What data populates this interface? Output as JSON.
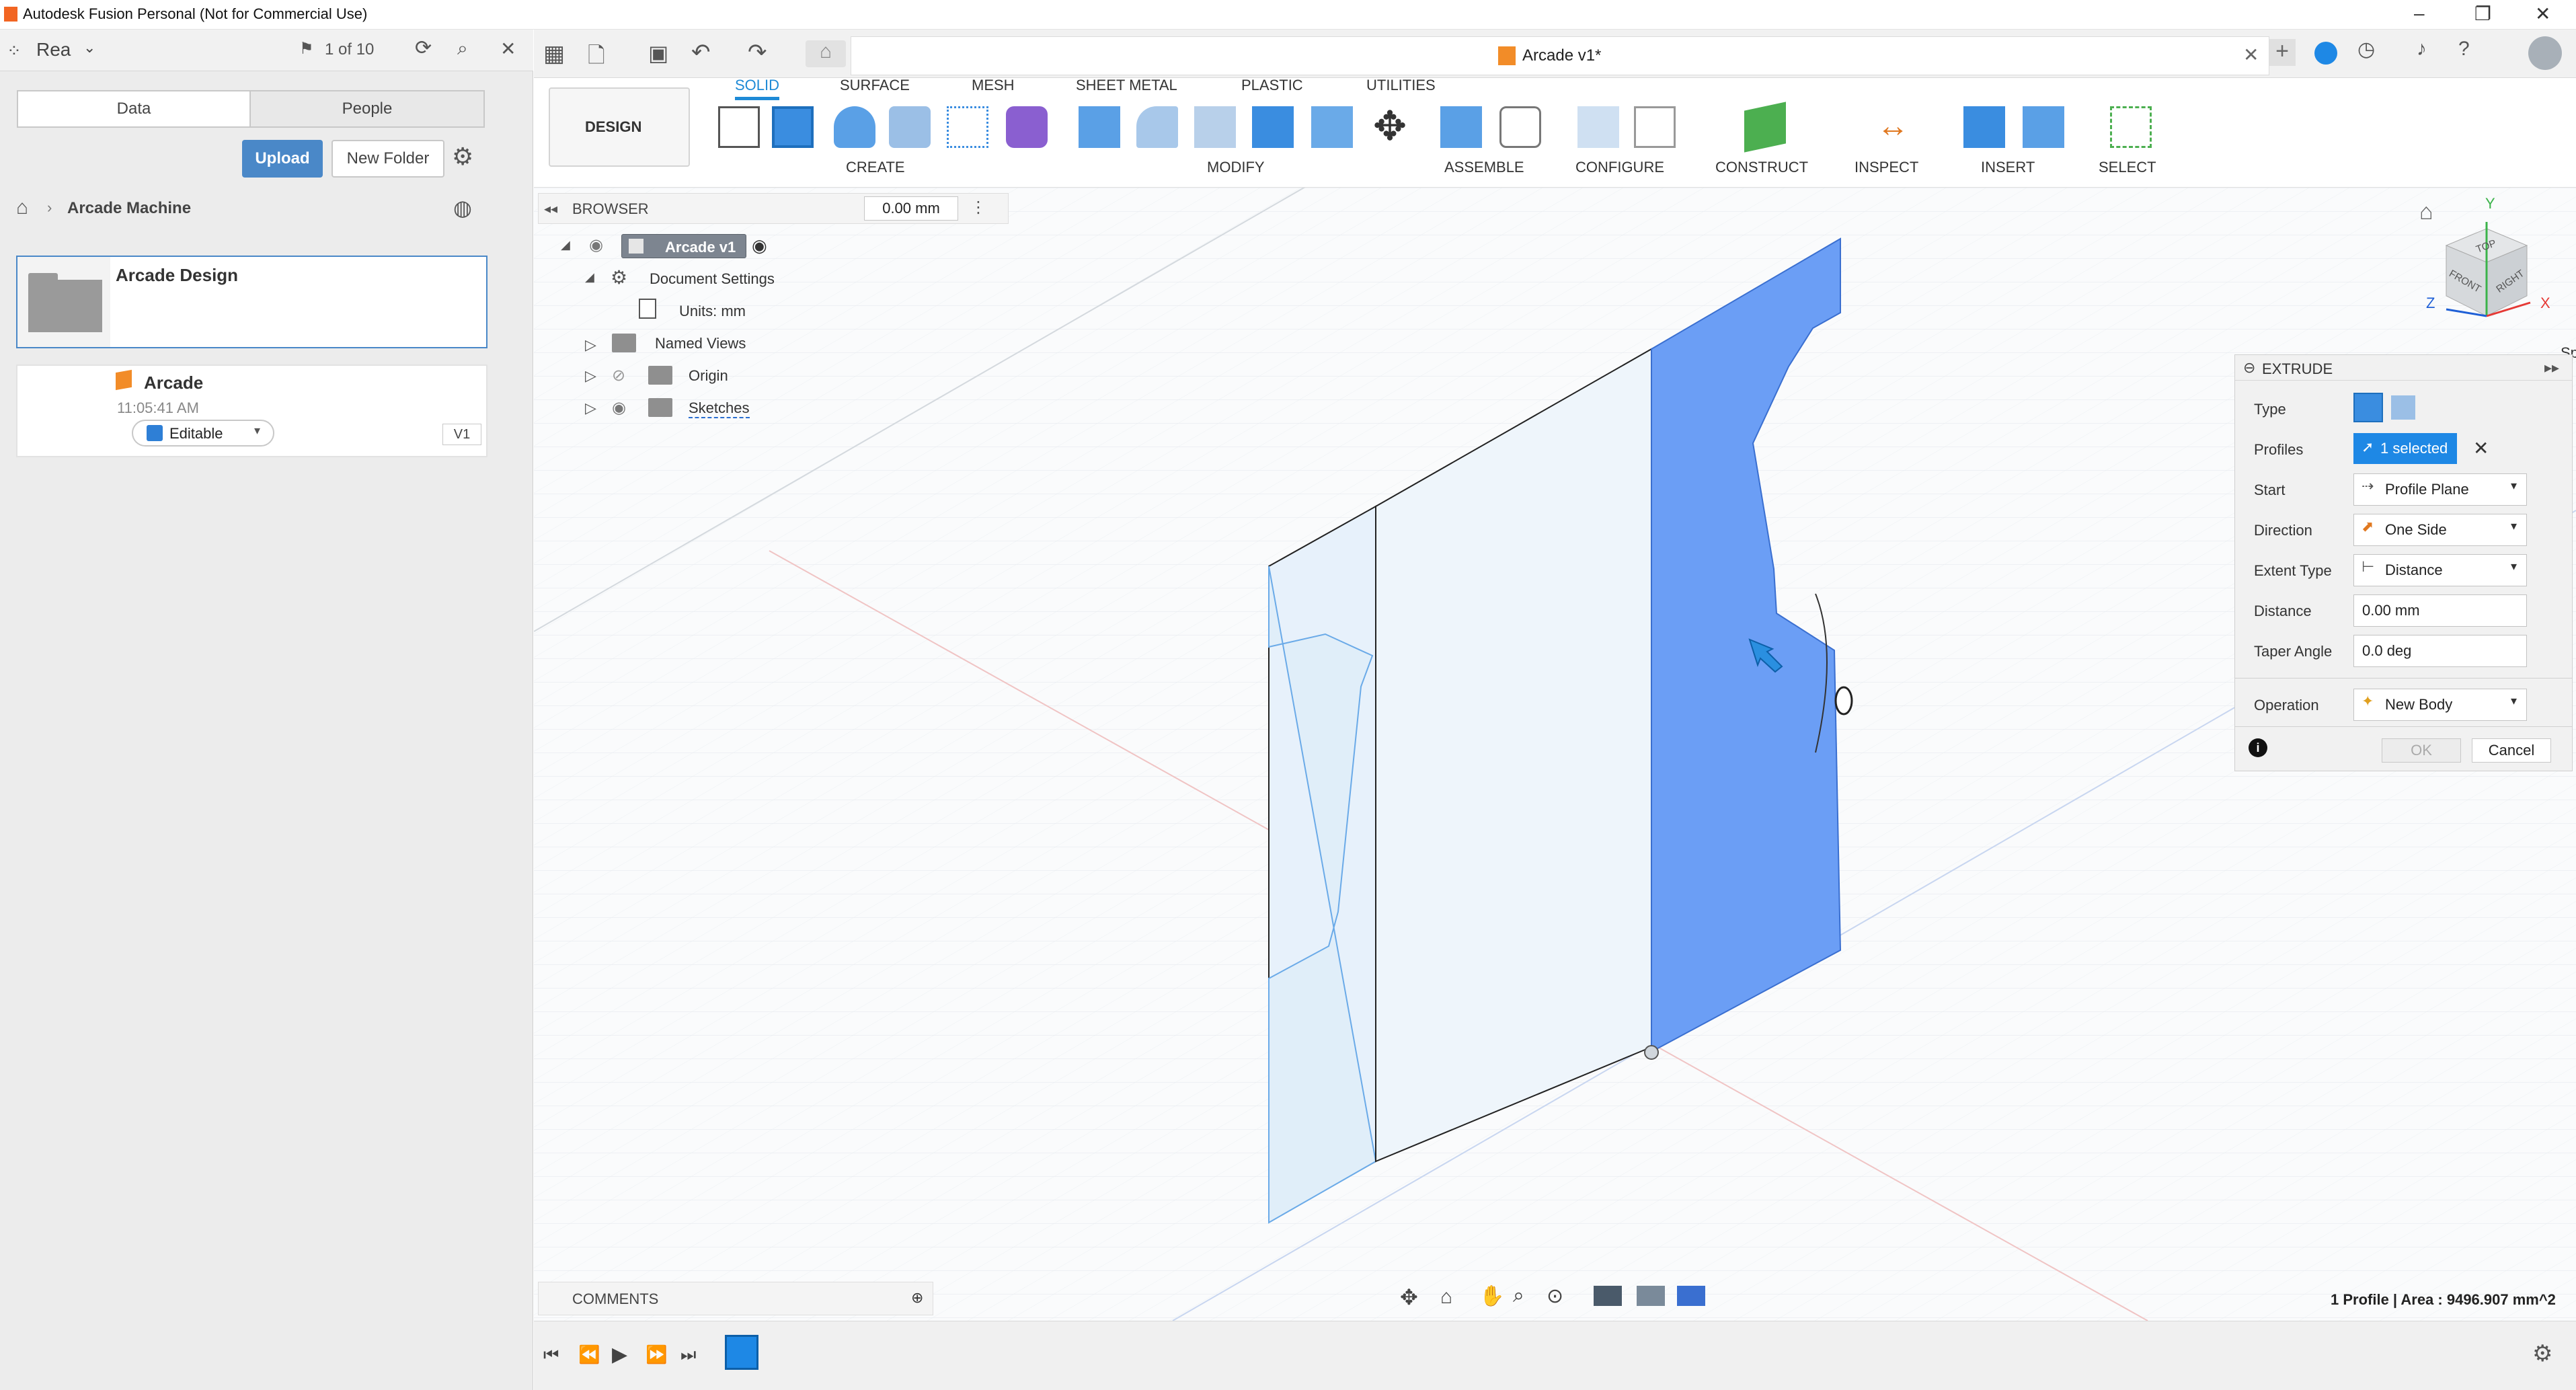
{
  "titlebar": {
    "title": "Autodesk Fusion Personal (Not for Commercial Use)"
  },
  "data_panel": {
    "hub_name": "Rea",
    "job_count": "1 of 10",
    "tabs": [
      "Data",
      "People"
    ],
    "upload_label": "Upload",
    "new_folder_label": "New Folder",
    "breadcrumb": "Arcade Machine",
    "items": [
      {
        "name": "Arcade Design"
      },
      {
        "name": "Arcade",
        "time": "11:05:41 AM",
        "status": "Editable",
        "version": "V1"
      }
    ]
  },
  "document": {
    "tab_title": "Arcade v1*"
  },
  "toolbar": {
    "workspace": "DESIGN",
    "tabs": [
      "SOLID",
      "SURFACE",
      "MESH",
      "SHEET METAL",
      "PLASTIC",
      "UTILITIES"
    ],
    "active_tab": "SOLID",
    "groups": [
      "CREATE",
      "MODIFY",
      "ASSEMBLE",
      "CONFIGURE",
      "CONSTRUCT",
      "INSPECT",
      "INSERT",
      "SELECT"
    ]
  },
  "browser": {
    "title": "BROWSER",
    "dimension_value": "0.00 mm",
    "tree": {
      "root": "Arcade v1",
      "document_settings": "Document Settings",
      "units": "Units: mm",
      "named_views": "Named Views",
      "origin": "Origin",
      "sketches": "Sketches"
    }
  },
  "viewcube": {
    "top": "TOP",
    "front": "FRONT",
    "right": "RIGHT",
    "y_axis": "Y",
    "x_axis": "X",
    "z_axis": "Z",
    "side_text": "Sp"
  },
  "extrude_panel": {
    "title": "EXTRUDE",
    "rows": {
      "type_label": "Type",
      "profiles_label": "Profiles",
      "profiles_value": "1 selected",
      "start_label": "Start",
      "start_value": "Profile Plane",
      "direction_label": "Direction",
      "direction_value": "One Side",
      "extent_label": "Extent Type",
      "extent_value": "Distance",
      "distance_label": "Distance",
      "distance_value": "0.00 mm",
      "taper_label": "Taper Angle",
      "taper_value": "0.0 deg",
      "operation_label": "Operation",
      "operation_value": "New Body"
    },
    "ok_label": "OK",
    "cancel_label": "Cancel"
  },
  "comments": {
    "label": "COMMENTS"
  },
  "status": {
    "text": "1 Profile | Area : 9496.907 mm^2"
  },
  "colors": {
    "accent": "#1e8ad6",
    "selection": "#6b9ef5",
    "profile_fill": "#e7f1fb"
  }
}
